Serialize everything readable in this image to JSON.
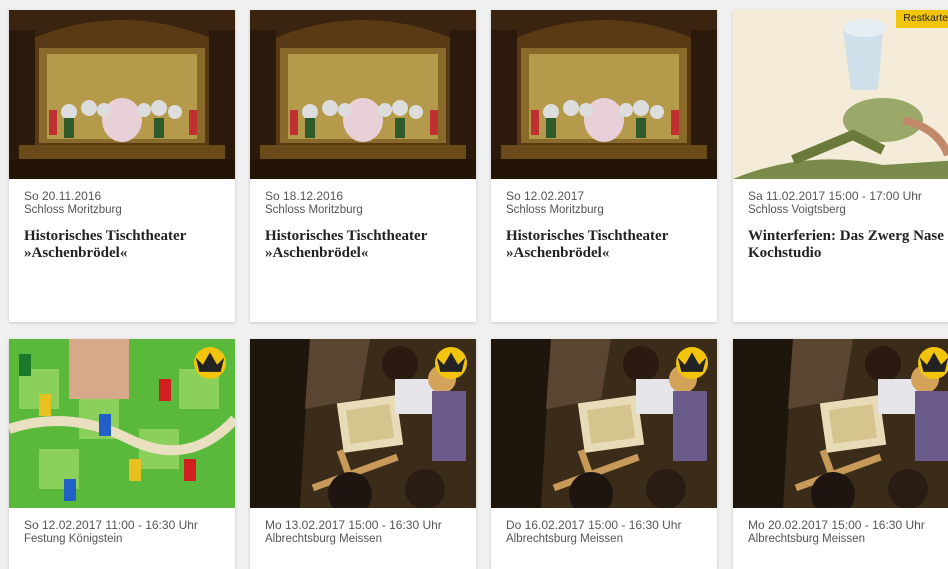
{
  "events": [
    {
      "date": "So 20.11.2016",
      "venue": "Schloss Moritzburg",
      "title": "Historisches Tischtheater »Aschenbrödel«"
    },
    {
      "date": "So 18.12.2016",
      "venue": "Schloss Moritzburg",
      "title": "Historisches Tischtheater »Aschenbrödel«"
    },
    {
      "date": "So 12.02.2017",
      "venue": "Schloss Moritzburg",
      "title": "Historisches Tischtheater »Aschenbrödel«"
    },
    {
      "date": "Sa 11.02.2017 15:00 - 17:00 Uhr",
      "venue": "Schloss Voigtsberg",
      "title": "Winterferien: Das Zwerg Nase Kochstudio",
      "badge": "Restkarten"
    },
    {
      "date": "So 12.02.2017 11:00 - 16:30 Uhr",
      "venue": "Festung Königstein"
    },
    {
      "date": "Mo 13.02.2017 15:00 - 16:30 Uhr",
      "venue": "Albrechtsburg Meissen"
    },
    {
      "date": "Do 16.02.2017 15:00 - 16:30 Uhr",
      "venue": "Albrechtsburg Meissen"
    },
    {
      "date": "Mo 20.02.2017 15:00 - 16:30 Uhr",
      "venue": "Albrechtsburg Meissen"
    }
  ],
  "icons": {
    "crown": "crown-icon"
  },
  "colors": {
    "accent": "#f2c40c"
  }
}
